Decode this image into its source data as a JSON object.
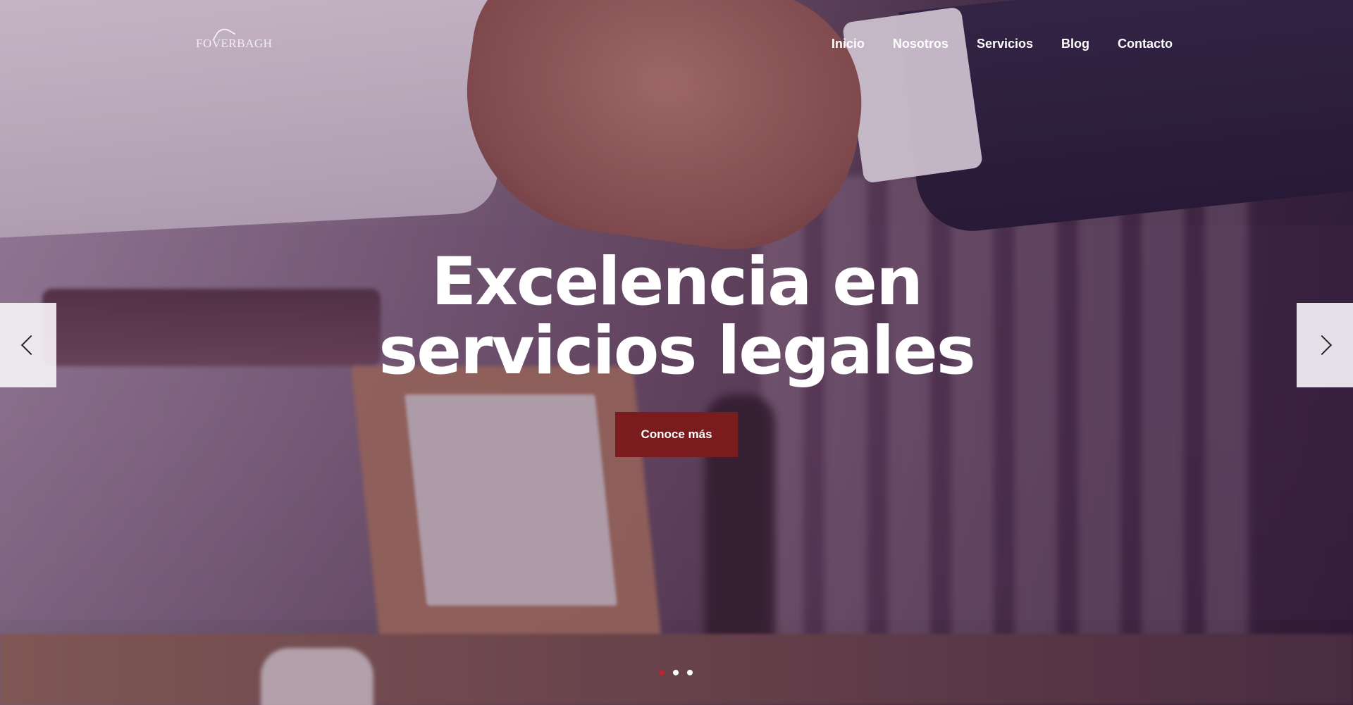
{
  "brand": {
    "logo_text": "FOVERBAGH"
  },
  "nav": {
    "items": [
      {
        "label": "Inicio"
      },
      {
        "label": "Nosotros"
      },
      {
        "label": "Servicios"
      },
      {
        "label": "Blog"
      },
      {
        "label": "Contacto"
      }
    ]
  },
  "hero": {
    "headline_line1": "Excelencia en",
    "headline_line2": "servicios legales",
    "cta_label": "Conoce más",
    "active_slide_index": 0,
    "slide_count": 3,
    "colors": {
      "accent": "#7a1c1d",
      "active_dot": "#c0232a"
    }
  },
  "icons": {
    "prev": "chevron-left-icon",
    "next": "chevron-right-icon"
  }
}
